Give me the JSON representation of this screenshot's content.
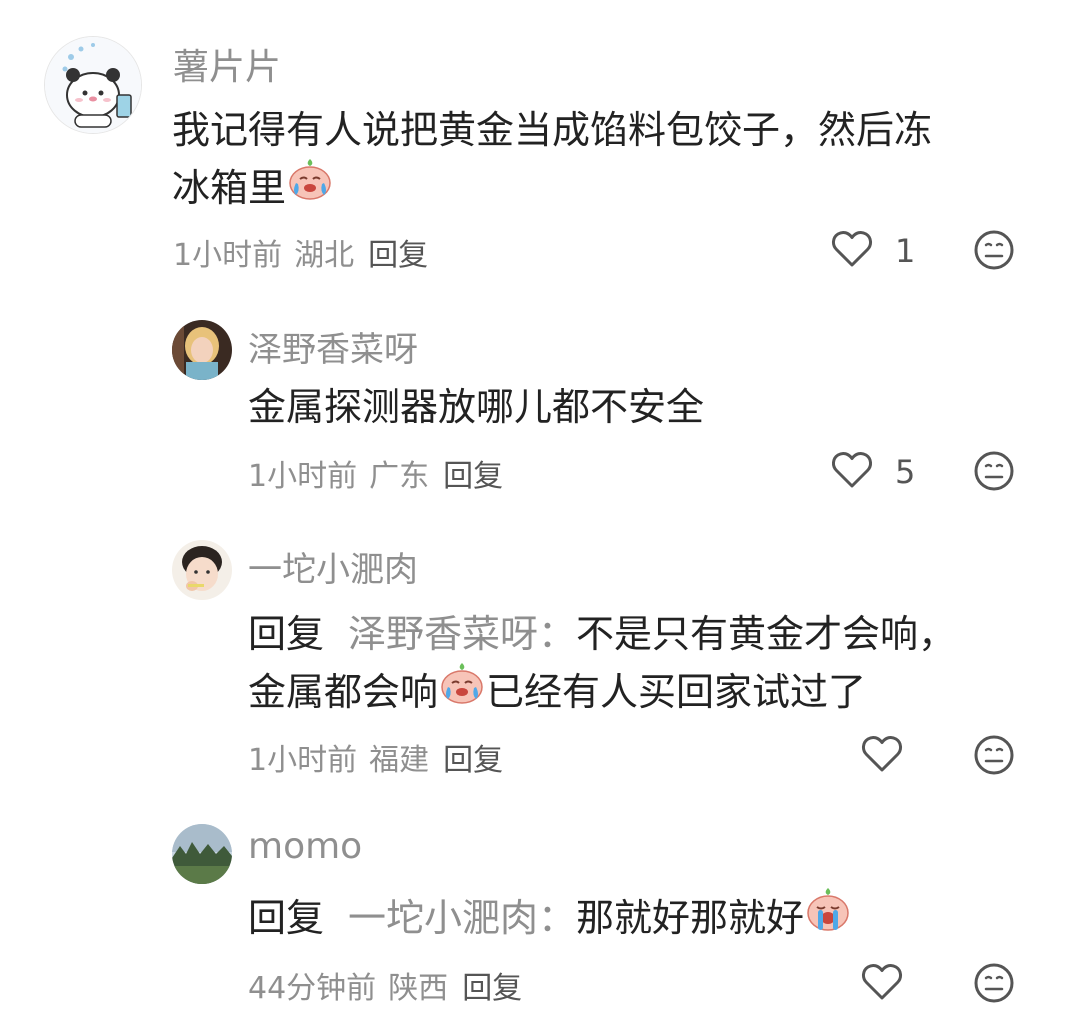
{
  "comments": [
    {
      "username": "薯片片",
      "lines": [
        "我记得有人说把黄金当成馅料包饺子，然后冻",
        "冰箱里"
      ],
      "emoji": "crying-face-emoji",
      "time": "1小时前",
      "location": "湖北",
      "reply_label": "回复",
      "likes": "1"
    },
    {
      "username": "泽野香菜呀",
      "text": "金属探测器放哪儿都不安全",
      "time": "1小时前",
      "location": "广东",
      "reply_label": "回复",
      "likes": "5"
    },
    {
      "username": "一坨小淝肉",
      "reply_prefix": "回复",
      "reply_target": "泽野香菜呀：",
      "line1_text": "不是只有黄金才会响，",
      "line2_before": "金属都会响",
      "line2_after": "已经有人买回家试过了",
      "emoji": "crying-face-emoji",
      "time": "1小时前",
      "location": "福建",
      "reply_label": "回复"
    },
    {
      "username": "momo",
      "reply_prefix": "回复",
      "reply_target": "一坨小淝肉：",
      "text": "那就好那就好",
      "emoji": "sobbing-face-emoji",
      "time": "44分钟前",
      "location": "陕西",
      "reply_label": "回复"
    }
  ],
  "icons": {
    "like": "heart-outline-icon",
    "dislike": "meh-face-icon"
  },
  "colors": {
    "text_primary": "#222222",
    "text_secondary": "#8f8f8f",
    "icon": "#555555"
  }
}
